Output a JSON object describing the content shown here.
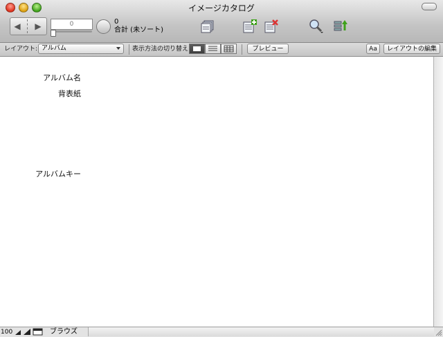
{
  "window": {
    "title": "イメージカタログ"
  },
  "toolbar": {
    "record_field_value": "0",
    "found_count": "0",
    "total_label": "合計 (未ソート)"
  },
  "layout_bar": {
    "layout_label": "レイアウト:",
    "layout_value": "アルバム",
    "view_as_label": "表示方法の切り替え:",
    "preview_label": "プレビュー",
    "text_format_label": "Aa",
    "edit_layout_label": "レイアウトの編集"
  },
  "fields": [
    {
      "label": "アルバム名"
    },
    {
      "label": "背表紙"
    },
    {
      "label": "アルバムキー"
    }
  ],
  "statusbar": {
    "zoom": "100",
    "mode": "ブラウズ"
  },
  "colors": {
    "titlebar": "#c4c4c4",
    "accent_green": "#3fa21b"
  }
}
